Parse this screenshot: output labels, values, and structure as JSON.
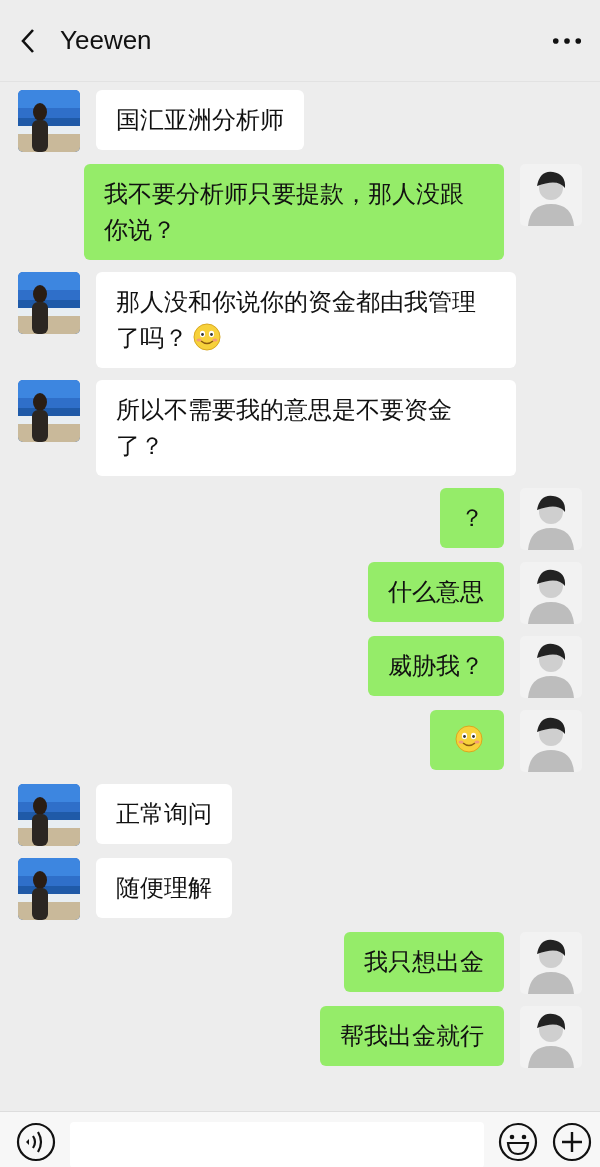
{
  "header": {
    "title": "Yeewen"
  },
  "messages": [
    {
      "outgoing": false,
      "text": "国汇亚洲分析师",
      "emoji": false
    },
    {
      "outgoing": true,
      "text": "我不要分析师只要提款，那人没跟你说？",
      "emoji": false
    },
    {
      "outgoing": false,
      "text": "那人没和你说你的资金都由我管理了吗？",
      "emoji": true
    },
    {
      "outgoing": false,
      "text": "所以不需要我的意思是不要资金了？",
      "emoji": false
    },
    {
      "outgoing": true,
      "text": "？",
      "emoji": false
    },
    {
      "outgoing": true,
      "text": "什么意思",
      "emoji": false
    },
    {
      "outgoing": true,
      "text": "威胁我？",
      "emoji": false
    },
    {
      "outgoing": true,
      "emoji": true
    },
    {
      "outgoing": false,
      "text": "正常询问",
      "emoji": false
    },
    {
      "outgoing": false,
      "text": "随便理解",
      "emoji": false
    },
    {
      "outgoing": true,
      "text": "我只想出金",
      "emoji": false
    },
    {
      "outgoing": true,
      "text": "帮我出金就行",
      "emoji": false
    }
  ]
}
